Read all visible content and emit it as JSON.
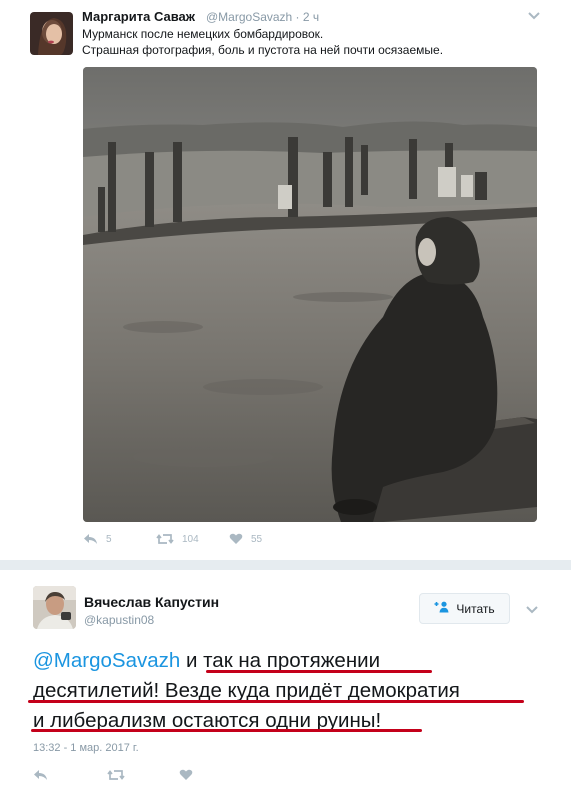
{
  "tweet1": {
    "author_name": "Маргарита Саваж",
    "handle_time": "@MargoSavazh · 2 ч",
    "text_lines": [
      "Мурманск после немецких бомбардировок.",
      "Страшная фотография, боль и пустота на ней почти осязаемые."
    ],
    "actions": {
      "reply_count": "5",
      "retweet_count": "104",
      "like_count": "55"
    },
    "icons": {
      "caret": "chevron-down-icon",
      "reply": "reply-icon",
      "retweet": "retweet-icon",
      "like": "heart-icon"
    }
  },
  "tweet2": {
    "author_name": "Вячеслав Капустин",
    "handle": "@kapustin08",
    "follow_label": "Читать",
    "mention": "@MargoSavazh",
    "text_line1_rest": " и так на протяжении",
    "text_line2": "десятилетий! Везде куда придёт демократия",
    "text_line3": "и либерализм остаются одни руины!",
    "timestamp": "13:32 - 1 мар. 2017 г.",
    "icons": {
      "follow": "add-user-icon",
      "caret": "chevron-down-icon",
      "reply": "reply-icon",
      "retweet": "retweet-icon",
      "like": "heart-icon"
    }
  },
  "colors": {
    "link": "#1b95e0",
    "muted": "#8899a6",
    "icon": "#aab8c2",
    "underline": "#c4001a",
    "separator": "#e6ecf0"
  }
}
